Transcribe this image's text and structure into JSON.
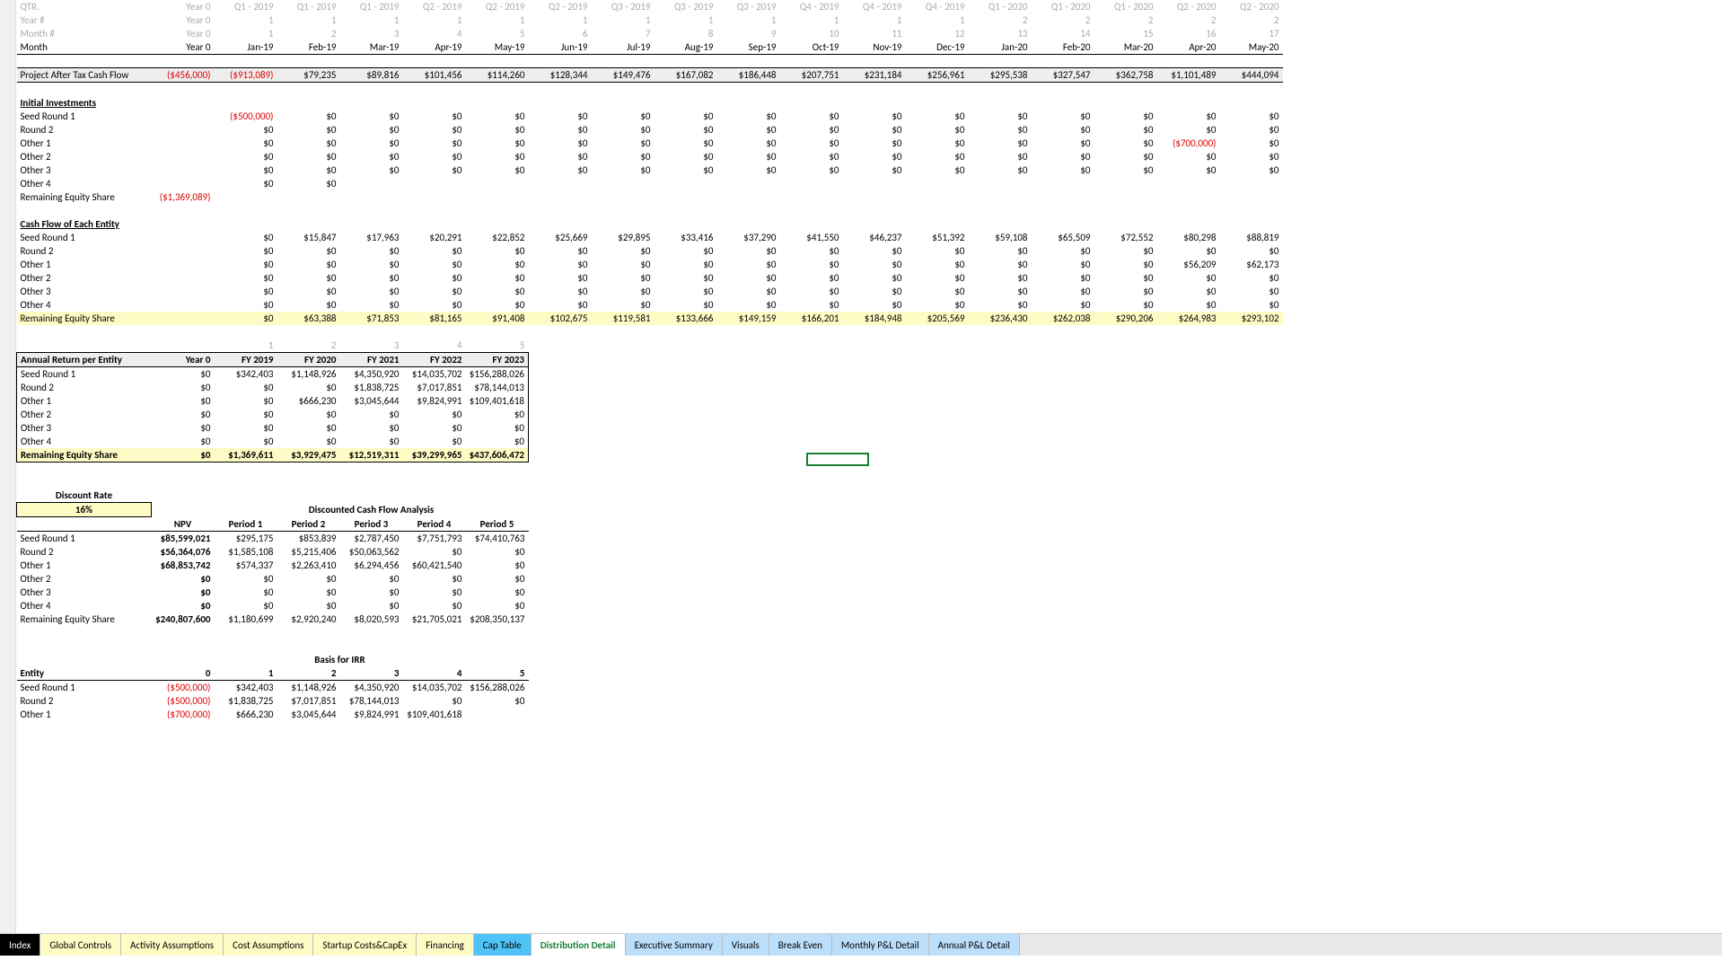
{
  "headers": {
    "qtr": [
      "QTR.",
      "Year 0",
      "Q1 - 2019",
      "Q1 - 2019",
      "Q1 - 2019",
      "Q2 - 2019",
      "Q2 - 2019",
      "Q2 - 2019",
      "Q3 - 2019",
      "Q3 - 2019",
      "Q3 - 2019",
      "Q4 - 2019",
      "Q4 - 2019",
      "Q4 - 2019",
      "Q1 - 2020",
      "Q1 - 2020",
      "Q1 - 2020",
      "Q2 - 2020",
      "Q2 - 2020"
    ],
    "year": [
      "Year #",
      "Year 0",
      "1",
      "1",
      "1",
      "1",
      "1",
      "1",
      "1",
      "1",
      "1",
      "1",
      "1",
      "1",
      "2",
      "2",
      "2",
      "2",
      "2"
    ],
    "monthnum": [
      "Month #",
      "Year 0",
      "1",
      "2",
      "3",
      "4",
      "5",
      "6",
      "7",
      "8",
      "9",
      "10",
      "11",
      "12",
      "13",
      "14",
      "15",
      "16",
      "17"
    ],
    "month": [
      "Month",
      "Year 0",
      "Jan-19",
      "Feb-19",
      "Mar-19",
      "Apr-19",
      "May-19",
      "Jun-19",
      "Jul-19",
      "Aug-19",
      "Sep-19",
      "Oct-19",
      "Nov-19",
      "Dec-19",
      "Jan-20",
      "Feb-20",
      "Mar-20",
      "Apr-20",
      "May-20"
    ]
  },
  "patcf": {
    "label": "Project After Tax Cash Flow",
    "values": [
      "($456,000)",
      "($913,089)",
      "$79,235",
      "$89,816",
      "$101,456",
      "$114,260",
      "$128,344",
      "$149,476",
      "$167,082",
      "$186,448",
      "$207,751",
      "$231,184",
      "$256,961",
      "$295,538",
      "$327,547",
      "$362,758",
      "$1,101,489",
      "$444,094"
    ]
  },
  "initial": {
    "title": "Initial Investments",
    "rows": [
      {
        "label": "Seed Round 1",
        "values": [
          "",
          "($500,000)",
          "$0",
          "$0",
          "$0",
          "$0",
          "$0",
          "$0",
          "$0",
          "$0",
          "$0",
          "$0",
          "$0",
          "$0",
          "$0",
          "$0",
          "$0",
          "$0"
        ],
        "neg": [
          "($500,000)"
        ]
      },
      {
        "label": "Round 2",
        "values": [
          "",
          "$0",
          "$0",
          "$0",
          "$0",
          "$0",
          "$0",
          "$0",
          "$0",
          "$0",
          "$0",
          "$0",
          "$0",
          "$0",
          "$0",
          "$0",
          "$0",
          "$0"
        ]
      },
      {
        "label": "Other 1",
        "values": [
          "",
          "$0",
          "$0",
          "$0",
          "$0",
          "$0",
          "$0",
          "$0",
          "$0",
          "$0",
          "$0",
          "$0",
          "$0",
          "$0",
          "$0",
          "$0",
          "($700,000)",
          "$0"
        ],
        "neg": [
          "($700,000)"
        ]
      },
      {
        "label": "Other 2",
        "values": [
          "",
          "$0",
          "$0",
          "$0",
          "$0",
          "$0",
          "$0",
          "$0",
          "$0",
          "$0",
          "$0",
          "$0",
          "$0",
          "$0",
          "$0",
          "$0",
          "$0",
          "$0"
        ]
      },
      {
        "label": "Other 3",
        "values": [
          "",
          "$0",
          "$0",
          "$0",
          "$0",
          "$0",
          "$0",
          "$0",
          "$0",
          "$0",
          "$0",
          "$0",
          "$0",
          "$0",
          "$0",
          "$0",
          "$0",
          "$0"
        ]
      },
      {
        "label": "Other 4",
        "values": [
          "",
          "$0",
          "$0",
          "",
          "",
          "",
          "",
          "",
          "",
          "",
          "",
          "",
          "",
          "",
          "",
          "",
          "",
          ""
        ]
      }
    ],
    "remaining": {
      "label": "Remaining Equity Share",
      "value": "($1,369,089)"
    }
  },
  "cfentity": {
    "title": "Cash Flow of Each Entity",
    "rows": [
      {
        "label": "Seed Round 1",
        "values": [
          "",
          "$0",
          "$15,847",
          "$17,963",
          "$20,291",
          "$22,852",
          "$25,669",
          "$29,895",
          "$33,416",
          "$37,290",
          "$41,550",
          "$46,237",
          "$51,392",
          "$59,108",
          "$65,509",
          "$72,552",
          "$80,298",
          "$88,819"
        ]
      },
      {
        "label": "Round 2",
        "values": [
          "",
          "$0",
          "$0",
          "$0",
          "$0",
          "$0",
          "$0",
          "$0",
          "$0",
          "$0",
          "$0",
          "$0",
          "$0",
          "$0",
          "$0",
          "$0",
          "$0",
          "$0"
        ]
      },
      {
        "label": "Other 1",
        "values": [
          "",
          "$0",
          "$0",
          "$0",
          "$0",
          "$0",
          "$0",
          "$0",
          "$0",
          "$0",
          "$0",
          "$0",
          "$0",
          "$0",
          "$0",
          "$0",
          "$56,209",
          "$62,173"
        ]
      },
      {
        "label": "Other 2",
        "values": [
          "",
          "$0",
          "$0",
          "$0",
          "$0",
          "$0",
          "$0",
          "$0",
          "$0",
          "$0",
          "$0",
          "$0",
          "$0",
          "$0",
          "$0",
          "$0",
          "$0",
          "$0"
        ]
      },
      {
        "label": "Other 3",
        "values": [
          "",
          "$0",
          "$0",
          "$0",
          "$0",
          "$0",
          "$0",
          "$0",
          "$0",
          "$0",
          "$0",
          "$0",
          "$0",
          "$0",
          "$0",
          "$0",
          "$0",
          "$0"
        ]
      },
      {
        "label": "Other 4",
        "values": [
          "",
          "$0",
          "$0",
          "$0",
          "$0",
          "$0",
          "$0",
          "$0",
          "$0",
          "$0",
          "$0",
          "$0",
          "$0",
          "$0",
          "$0",
          "$0",
          "$0",
          "$0"
        ]
      }
    ],
    "remaining": {
      "label": "Remaining Equity Share",
      "values": [
        "",
        "$0",
        "$63,388",
        "$71,853",
        "$81,165",
        "$91,408",
        "$102,675",
        "$119,581",
        "$133,666",
        "$149,159",
        "$166,201",
        "$184,948",
        "$205,569",
        "$236,430",
        "$262,038",
        "$290,206",
        "$264,983",
        "$293,102"
      ]
    }
  },
  "annual": {
    "idx": [
      "",
      "",
      "1",
      "2",
      "3",
      "4",
      "5"
    ],
    "header": [
      "Annual Return per Entity",
      "Year 0",
      "FY 2019",
      "FY 2020",
      "FY 2021",
      "FY 2022",
      "FY 2023"
    ],
    "rows": [
      {
        "label": "Seed Round 1",
        "values": [
          "$0",
          "$342,403",
          "$1,148,926",
          "$4,350,920",
          "$14,035,702",
          "$156,288,026"
        ]
      },
      {
        "label": "Round 2",
        "values": [
          "$0",
          "$0",
          "$0",
          "$1,838,725",
          "$7,017,851",
          "$78,144,013"
        ]
      },
      {
        "label": "Other 1",
        "values": [
          "$0",
          "$0",
          "$666,230",
          "$3,045,644",
          "$9,824,991",
          "$109,401,618"
        ]
      },
      {
        "label": "Other 2",
        "values": [
          "$0",
          "$0",
          "$0",
          "$0",
          "$0",
          "$0"
        ]
      },
      {
        "label": "Other 3",
        "values": [
          "$0",
          "$0",
          "$0",
          "$0",
          "$0",
          "$0"
        ]
      },
      {
        "label": "Other 4",
        "values": [
          "$0",
          "$0",
          "$0",
          "$0",
          "$0",
          "$0"
        ]
      }
    ],
    "remaining": {
      "label": "Remaining Equity Share",
      "values": [
        "$0",
        "$1,369,611",
        "$3,929,475",
        "$12,519,311",
        "$39,299,965",
        "$437,606,472"
      ]
    }
  },
  "discount": {
    "label": "Discount Rate",
    "value": "16%"
  },
  "dcf": {
    "title": "Discounted Cash Flow Analysis",
    "header": [
      "",
      "NPV",
      "Period 1",
      "Period 2",
      "Period 3",
      "Period 4",
      "Period 5"
    ],
    "rows": [
      {
        "label": "Seed Round 1",
        "values": [
          "$85,599,021",
          "$295,175",
          "$853,839",
          "$2,787,450",
          "$7,751,793",
          "$74,410,763"
        ]
      },
      {
        "label": "Round 2",
        "values": [
          "$56,364,076",
          "$1,585,108",
          "$5,215,406",
          "$50,063,562",
          "$0",
          "$0"
        ]
      },
      {
        "label": "Other 1",
        "values": [
          "$68,853,742",
          "$574,337",
          "$2,263,410",
          "$6,294,456",
          "$60,421,540",
          "$0"
        ]
      },
      {
        "label": "Other 2",
        "values": [
          "$0",
          "$0",
          "$0",
          "$0",
          "$0",
          "$0"
        ]
      },
      {
        "label": "Other 3",
        "values": [
          "$0",
          "$0",
          "$0",
          "$0",
          "$0",
          "$0"
        ]
      },
      {
        "label": "Other 4",
        "values": [
          "$0",
          "$0",
          "$0",
          "$0",
          "$0",
          "$0"
        ]
      },
      {
        "label": "Remaining Equity Share",
        "values": [
          "$240,807,600",
          "$1,180,699",
          "$2,920,240",
          "$8,020,593",
          "$21,705,021",
          "$208,350,137"
        ]
      }
    ]
  },
  "irr": {
    "title": "Basis for IRR",
    "header": [
      "Entity",
      "0",
      "1",
      "2",
      "3",
      "4",
      "5"
    ],
    "rows": [
      {
        "label": "Seed Round 1",
        "values": [
          "($500,000)",
          "$342,403",
          "$1,148,926",
          "$4,350,920",
          "$14,035,702",
          "$156,288,026"
        ],
        "neg": [
          0
        ]
      },
      {
        "label": "Round 2",
        "values": [
          "($500,000)",
          "$1,838,725",
          "$7,017,851",
          "$78,144,013",
          "$0",
          "$0"
        ],
        "neg": [
          0
        ]
      },
      {
        "label": "Other 1",
        "values": [
          "($700,000)",
          "$666,230",
          "$3,045,644",
          "$9,824,991",
          "$109,401,618",
          ""
        ],
        "neg": [
          0
        ]
      }
    ]
  },
  "tabs": [
    {
      "label": "Index",
      "style": "black"
    },
    {
      "label": "Global Controls",
      "style": "yellow"
    },
    {
      "label": "Activity Assumptions",
      "style": "yellow"
    },
    {
      "label": "Cost Assumptions",
      "style": "yellow"
    },
    {
      "label": "Startup Costs&CapEx",
      "style": "yellow"
    },
    {
      "label": "Financing",
      "style": "yellow"
    },
    {
      "label": "Cap Table",
      "style": "lblue"
    },
    {
      "label": "Distribution Detail",
      "style": "green"
    },
    {
      "label": "Executive Summary",
      "style": "blue"
    },
    {
      "label": "Visuals",
      "style": "blue"
    },
    {
      "label": "Break Even",
      "style": "blue"
    },
    {
      "label": "Monthly P&L Detail",
      "style": "blue"
    },
    {
      "label": "Annual P&L Detail",
      "style": "blue"
    }
  ]
}
